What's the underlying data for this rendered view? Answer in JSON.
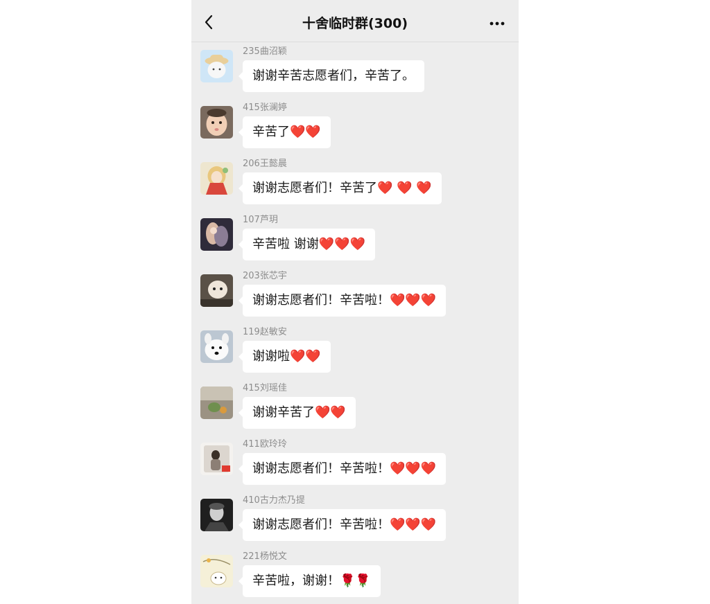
{
  "header": {
    "title": "十舍临时群(300)",
    "back_icon": "chevron-left-icon",
    "more_icon": "more-horizontal-icon"
  },
  "messages": [
    {
      "sender": "235曲沼颖",
      "text": "谢谢辛苦志愿者们，辛苦了。"
    },
    {
      "sender": "415张澜婷",
      "text": "辛苦了❤️❤️"
    },
    {
      "sender": "206王懿晨",
      "text": "谢谢志愿者们！辛苦了❤️ ❤️ ❤️"
    },
    {
      "sender": "107芦玥",
      "text": "辛苦啦 谢谢❤️❤️❤️"
    },
    {
      "sender": "203张芯宇",
      "text": "谢谢志愿者们！辛苦啦！❤️❤️❤️"
    },
    {
      "sender": "119赵敏安",
      "text": "谢谢啦❤️❤️"
    },
    {
      "sender": "415刘瑶佳",
      "text": "谢谢辛苦了❤️❤️"
    },
    {
      "sender": "411欧玲玲",
      "text": "谢谢志愿者们！辛苦啦！❤️❤️❤️"
    },
    {
      "sender": "410古力杰乃提",
      "text": "谢谢志愿者们！辛苦啦！❤️❤️❤️"
    },
    {
      "sender": "221杨悦文",
      "text": "辛苦啦，谢谢！🌹🌹"
    }
  ]
}
